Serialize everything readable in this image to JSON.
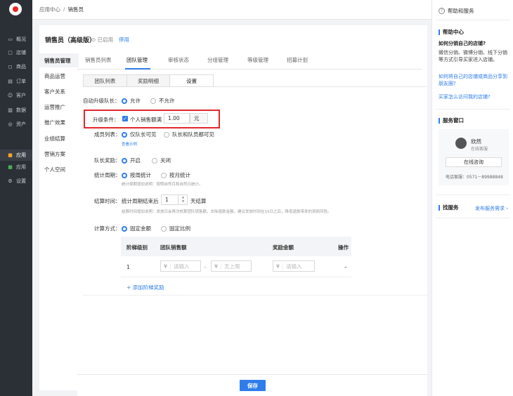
{
  "nav": {
    "items": [
      {
        "icon": "chat-icon",
        "label": "概况"
      },
      {
        "icon": "store-icon",
        "label": "店铺"
      },
      {
        "icon": "bag-icon",
        "label": "商品"
      },
      {
        "icon": "order-icon",
        "label": "订单"
      },
      {
        "icon": "user-icon",
        "label": "客户"
      },
      {
        "icon": "chart-icon",
        "label": "数据"
      },
      {
        "icon": "asset-icon",
        "label": "资产"
      },
      {
        "icon": "apps-icon",
        "label": "应用"
      },
      {
        "icon": "apps-color-icon",
        "label": "应用"
      },
      {
        "icon": "gear-icon",
        "label": "设置"
      }
    ]
  },
  "breadcrumb": {
    "parent": "应用中心",
    "separator": "/",
    "current": "销售员"
  },
  "page": {
    "title": "销售员（高级版）",
    "status": "已启用",
    "disable_label": "停用"
  },
  "subnav": [
    "销售员管理",
    "商品运营",
    "客户关系",
    "运营推广",
    "推广效果",
    "业绩结算",
    "营销方案",
    "个人空间"
  ],
  "tabs": [
    "销售员列表",
    "团队管理",
    "审核状态",
    "分组管理",
    "等级管理",
    "招募计划"
  ],
  "subtabs": [
    "团队列表",
    "奖励明细",
    "设置"
  ],
  "form": {
    "auto_upgrade": {
      "label": "自动升级队长：",
      "options": [
        "允许",
        "不允许"
      ]
    },
    "upgrade_condition": {
      "label": "升级条件：",
      "checkbox_label": "个人销售额满",
      "amount": "1.00",
      "unit": "元"
    },
    "member_list": {
      "label": "成员列表：",
      "options": [
        "仅队长可见",
        "队长和队员都可见"
      ],
      "example_link": "查看示例"
    },
    "leader_reward": {
      "label": "队长奖励：",
      "options": [
        "开启",
        "关闭"
      ]
    },
    "stat_period": {
      "label": "统计周期：",
      "options": [
        "按周统计",
        "按月统计"
      ],
      "hint": "统计周期增加说明：按照自然月和自然日统计。"
    },
    "settle_time": {
      "label": "结算时间：",
      "prefix": "统计周期结束后",
      "days": "1",
      "suffix": "天结算",
      "hint": "结算时间增加说明：发放日会再次核算团队销售额，去除退款金额。建议发放时间在15日之后，降低退款带来的资损风险。"
    },
    "calc_method": {
      "label": "计算方式：",
      "options": [
        "固定金额",
        "固定比例"
      ]
    }
  },
  "table": {
    "headers": [
      "阶梯级别",
      "团队销售额",
      "奖励金额",
      "操作"
    ],
    "rows": [
      {
        "level": "1",
        "currency": "¥",
        "min_placeholder": "请输入",
        "dash": "–",
        "max_placeholder": "无上限",
        "reward_placeholder": "请输入",
        "action": "–"
      }
    ],
    "add_label": "+ 添加阶梯奖励"
  },
  "footer": {
    "save_label": "保存"
  },
  "help": {
    "title": "帮助和服务",
    "section1": "帮助中心",
    "q1": "如何分销自己的店铺?",
    "a1": "微信分销、微博分销、线下分销等方式引导买家进入店铺。",
    "link1": "如何将自己的店铺或商品分享到朋友圈?",
    "link2": "买家怎么访问我的店铺?",
    "section2": "服务窗口",
    "agent_name": "欣然",
    "agent_role": "在线客服",
    "online_btn": "在线咨询",
    "phone": "电话客服：0571－89988848",
    "section3": "找服务",
    "post_demand": "发布服务需求 ›"
  },
  "colors": {
    "accent": "#2f7dea",
    "highlight": "#e4262c",
    "nav_bg": "#2b2f36"
  }
}
